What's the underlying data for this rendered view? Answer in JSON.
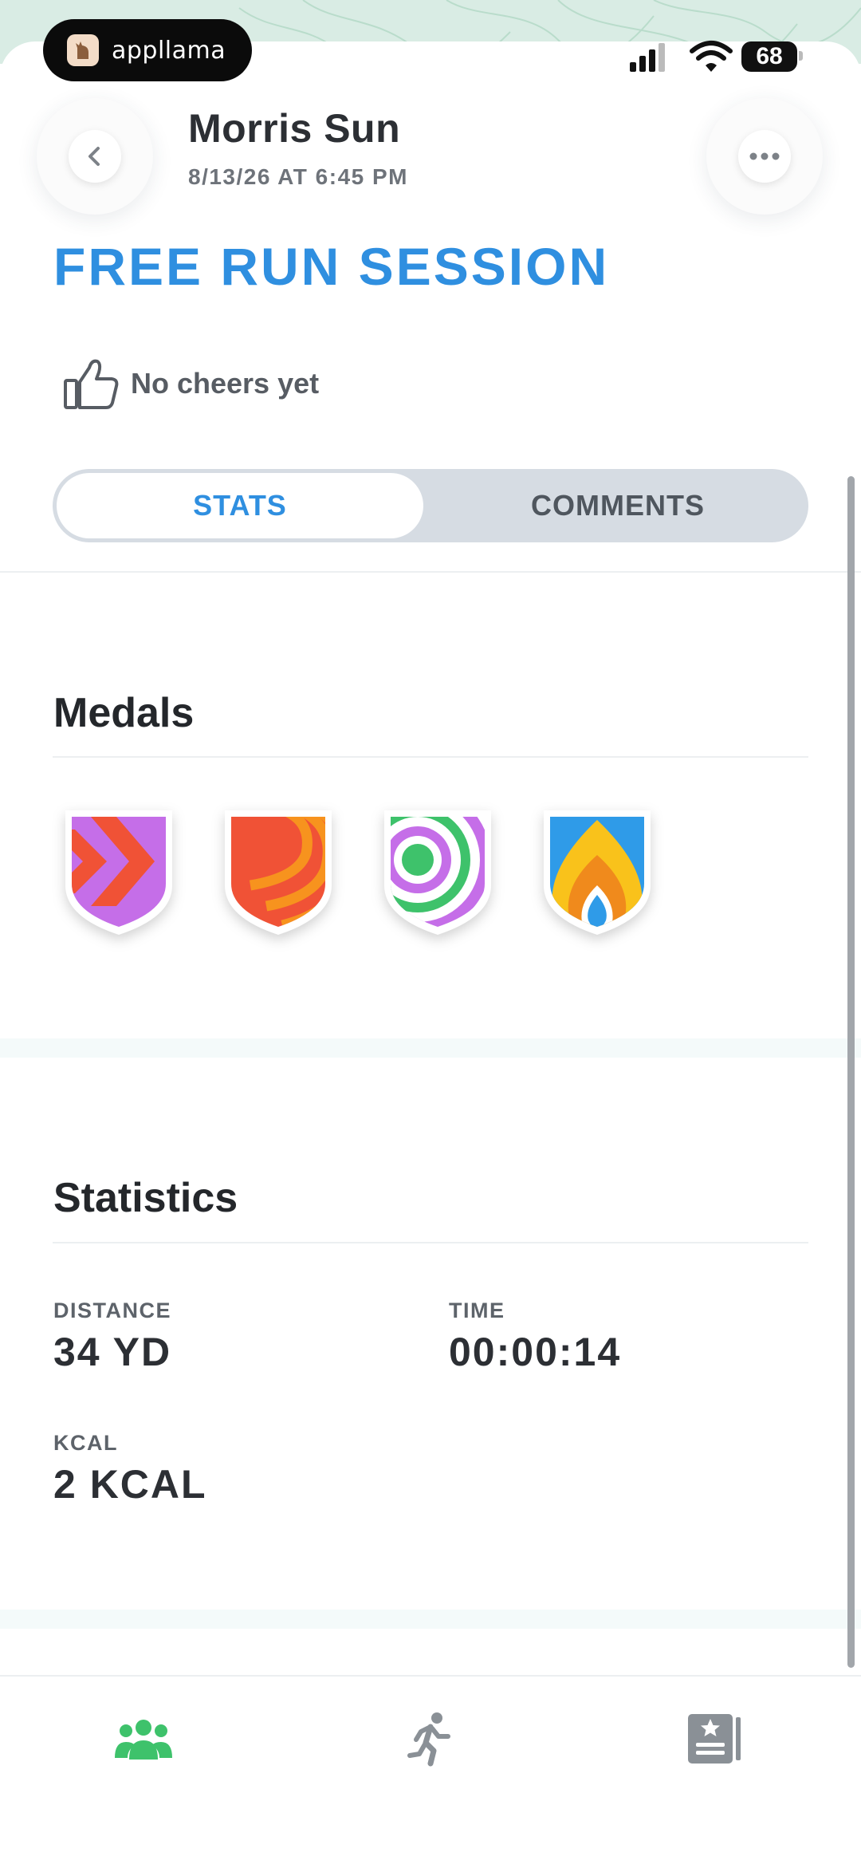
{
  "status_bar": {
    "app_name": "appllama",
    "battery": "68"
  },
  "header": {
    "user_name": "Morris Sun",
    "datetime": "8/13/26 AT 6:45 PM",
    "title": "FREE RUN SESSION"
  },
  "cheers": {
    "label": "No cheers yet"
  },
  "tabs": {
    "stats_label": "STATS",
    "comments_label": "COMMENTS",
    "selected": "STATS"
  },
  "medals": {
    "title": "Medals",
    "items": [
      {
        "name": "chevron-medal-icon",
        "colors": [
          "#c56ee8",
          "#f05236"
        ]
      },
      {
        "name": "stripes-medal-icon",
        "colors": [
          "#f05236",
          "#f7931e"
        ]
      },
      {
        "name": "target-medal-icon",
        "colors": [
          "#c56ee8",
          "#3ec26b"
        ]
      },
      {
        "name": "flame-medal-icon",
        "colors": [
          "#2f9be8",
          "#f9c21b",
          "#f08a1c"
        ]
      }
    ]
  },
  "statistics": {
    "title": "Statistics",
    "items": [
      {
        "label": "DISTANCE",
        "value": "34 YD"
      },
      {
        "label": "TIME",
        "value": "00:00:14"
      },
      {
        "label": "KCAL",
        "value": "2 KCAL"
      }
    ]
  },
  "tab_bar": {
    "items": [
      {
        "name": "community-tab",
        "icon": "people-icon",
        "active": true
      },
      {
        "name": "run-tab",
        "icon": "runner-icon",
        "active": false
      },
      {
        "name": "journal-tab",
        "icon": "journal-star-icon",
        "active": false
      }
    ]
  },
  "colors": {
    "accent": "#2f8fe0",
    "active_tab": "#3ec26b",
    "inactive_tab": "#8a9096"
  }
}
